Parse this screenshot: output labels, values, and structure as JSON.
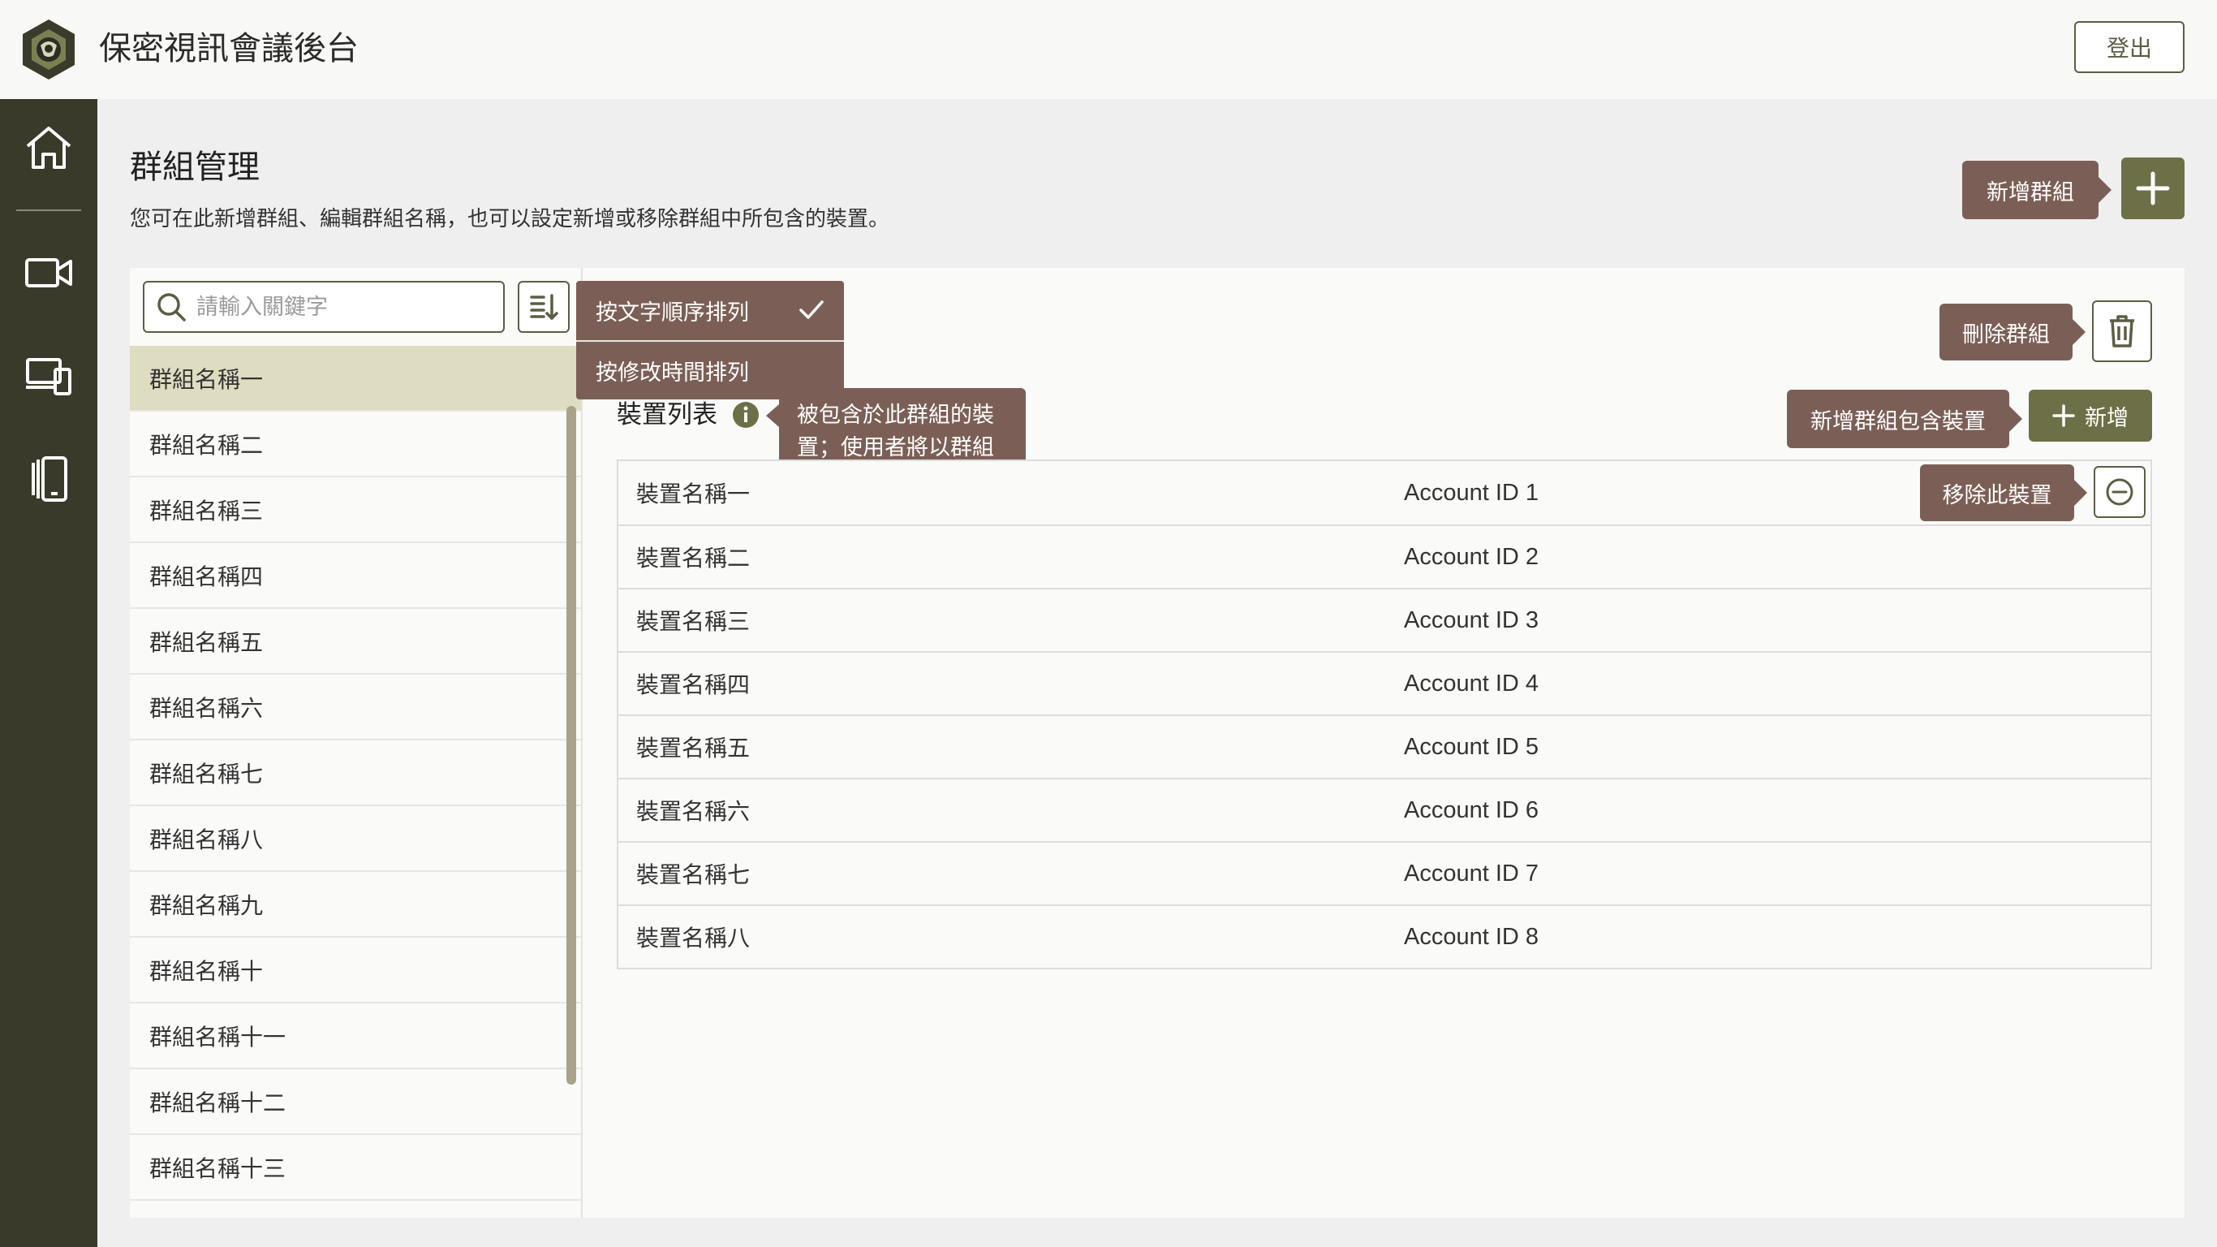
{
  "app": {
    "title": "保密視訊會議後台",
    "logout_label": "登出"
  },
  "nav": {
    "items": [
      {
        "icon": "home-icon"
      },
      {
        "icon": "video-camera-icon"
      },
      {
        "icon": "devices-icon"
      },
      {
        "icon": "tablet-icon"
      }
    ]
  },
  "page": {
    "title": "群組管理",
    "description": "您可在此新增群組、編輯群組名稱，也可以設定新增或移除群組中所包含的裝置。"
  },
  "tooltips": {
    "add_group": "新增群組",
    "delete_group": "刪除群組",
    "add_device": "新增群組包含裝置",
    "remove_device": "移除此裝置",
    "device_list_info": "被包含於此群組的裝置；使用者將以群組為單位設定其在登入裝置中通訊錄列表所列出的裝置"
  },
  "search": {
    "placeholder": "請輸入關鍵字"
  },
  "sort_menu": {
    "options": [
      "按文字順序排列",
      "按修改時間排列"
    ],
    "selected_index": 0
  },
  "groups": [
    "群組名稱一",
    "群組名稱二",
    "群組名稱三",
    "群組名稱四",
    "群組名稱五",
    "群組名稱六",
    "群組名稱七",
    "群組名稱八",
    "群組名稱九",
    "群組名稱十",
    "群組名稱十一",
    "群組名稱十二",
    "群組名稱十三"
  ],
  "selected_group_index": 0,
  "device_section": {
    "title": "裝置列表",
    "add_label": "新增"
  },
  "devices": [
    {
      "name": "裝置名稱一",
      "account": "Account ID 1"
    },
    {
      "name": "裝置名稱二",
      "account": "Account ID 2"
    },
    {
      "name": "裝置名稱三",
      "account": "Account ID 3"
    },
    {
      "name": "裝置名稱四",
      "account": "Account ID 4"
    },
    {
      "name": "裝置名稱五",
      "account": "Account ID 5"
    },
    {
      "name": "裝置名稱六",
      "account": "Account ID 6"
    },
    {
      "name": "裝置名稱七",
      "account": "Account ID 7"
    },
    {
      "name": "裝置名稱八",
      "account": "Account ID 8"
    }
  ],
  "colors": {
    "nav_bg": "#393a2a",
    "accent_green": "#6d7047",
    "tooltip_brown": "#7b5f56",
    "selected_row": "#dedcc1"
  }
}
